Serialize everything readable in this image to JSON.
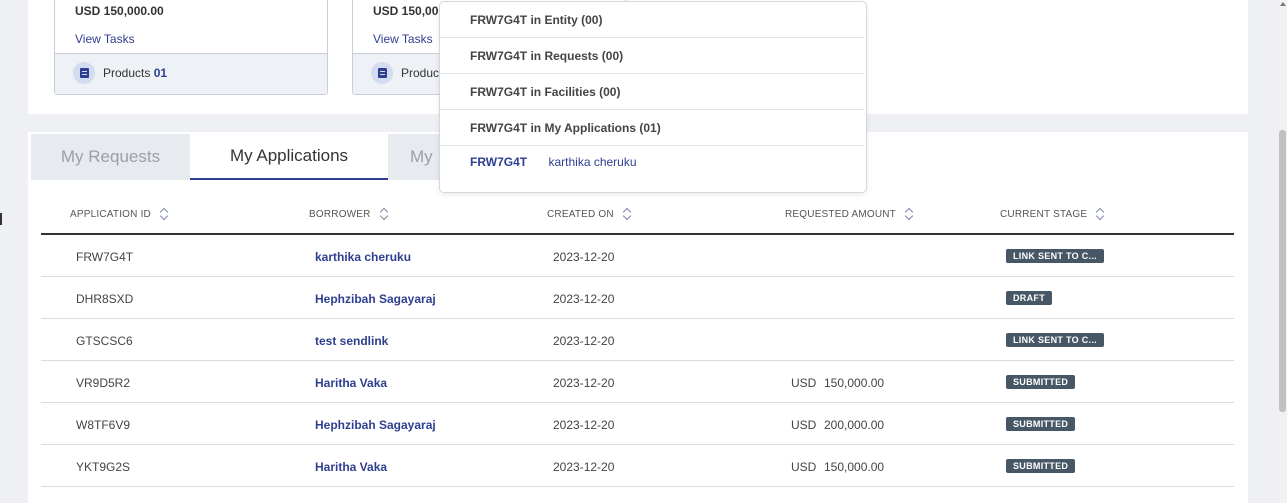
{
  "cards": [
    {
      "amount": "USD 150,000.00",
      "tasks_label": "View Tasks",
      "products_label": "Products",
      "products_count": "01"
    },
    {
      "amount": "USD 150,000",
      "tasks_label": "View Tasks",
      "products_label": "Produc"
    }
  ],
  "tabs": [
    "My Requests",
    "My Applications",
    "My"
  ],
  "table": {
    "headers": [
      "APPLICATION ID",
      "BORROWER",
      "CREATED ON",
      "REQUESTED AMOUNT",
      "CURRENT STAGE"
    ],
    "rows": [
      {
        "id": "FRW7G4T",
        "borrower": "karthika cheruku",
        "created": "2023-12-20",
        "currency": "",
        "amount": "",
        "stage": "LINK SENT TO C..."
      },
      {
        "id": "DHR8SXD",
        "borrower": "Hephzibah Sagayaraj",
        "created": "2023-12-20",
        "currency": "",
        "amount": "",
        "stage": "DRAFT"
      },
      {
        "id": "GTSCSC6",
        "borrower": "test sendlink",
        "created": "2023-12-20",
        "currency": "",
        "amount": "",
        "stage": "LINK SENT TO C..."
      },
      {
        "id": "VR9D5R2",
        "borrower": "Haritha Vaka",
        "created": "2023-12-20",
        "currency": "USD",
        "amount": "150,000.00",
        "stage": "SUBMITTED"
      },
      {
        "id": "W8TF6V9",
        "borrower": "Hephzibah Sagayaraj",
        "created": "2023-12-20",
        "currency": "USD",
        "amount": "200,000.00",
        "stage": "SUBMITTED"
      },
      {
        "id": "YKT9G2S",
        "borrower": "Haritha Vaka",
        "created": "2023-12-20",
        "currency": "USD",
        "amount": "150,000.00",
        "stage": "SUBMITTED"
      }
    ]
  },
  "search_dropdown": {
    "items": [
      "FRW7G4T in Entity (00)",
      "FRW7G4T in Requests (00)",
      "FRW7G4T in Facilities (00)",
      "FRW7G4T in My Applications (01)"
    ],
    "result": {
      "id": "FRW7G4T",
      "name": "karthika cheruku"
    }
  },
  "colors": {
    "accent": "#2f3f8f",
    "badge": "#475766"
  }
}
